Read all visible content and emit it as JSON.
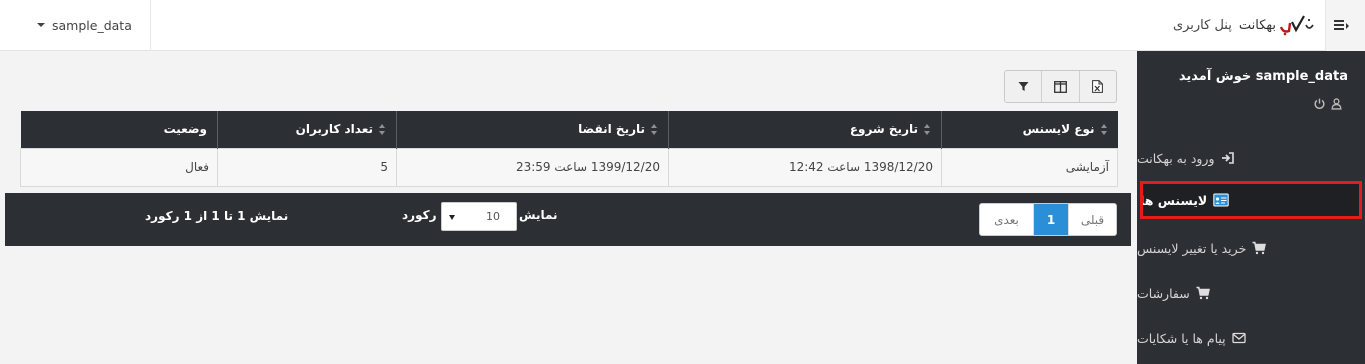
{
  "topbar": {
    "user_dropdown": "sample_data",
    "brand_name": "بهکانت",
    "panel_title": "پنل کاربری"
  },
  "sidebar": {
    "welcome": "sample_data خوش آمدید",
    "items": [
      {
        "label": "ورود به بهکانت",
        "icon": "sign-in-icon"
      },
      {
        "label": "لایسنس ها",
        "icon": "id-card-icon",
        "active": true
      },
      {
        "label": "خرید یا تغییر لایسنس",
        "icon": "cart-icon"
      },
      {
        "label": "سفارشات",
        "icon": "cart-icon"
      },
      {
        "label": "پیام ها یا شکایات",
        "icon": "envelope-icon"
      }
    ]
  },
  "toolbar": {
    "buttons": [
      "excel-export-icon",
      "columns-icon",
      "filter-icon"
    ]
  },
  "table": {
    "columns": [
      "نوع لایسنس",
      "تاریخ شروع",
      "تاریخ انقضا",
      "تعداد کاربران",
      "وضعیت"
    ],
    "rows": [
      [
        "آزمایشی",
        "1398/12/20 ساعت 12:42",
        "1399/12/20 ساعت 23:59",
        "5",
        "فعال"
      ]
    ]
  },
  "footer": {
    "prev": "قبلی",
    "current_page": "1",
    "next": "بعدی",
    "show_label": "نمایش",
    "page_size": "10",
    "records_label": "رکورد",
    "info": "نمایش 1 تا 1 از 1 رکورد"
  },
  "colors": {
    "sidebar_bg": "#2c2f34",
    "active_outline": "#e41c1c",
    "pager_active": "#2a8fd6"
  }
}
